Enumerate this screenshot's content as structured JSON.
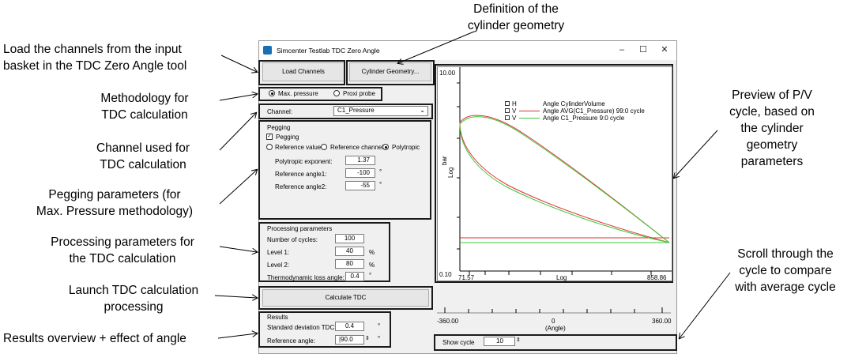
{
  "window": {
    "title": "Simcenter Testlab TDC Zero Angle",
    "minimize": "–",
    "maximize": "☐",
    "close": "✕"
  },
  "buttons": {
    "load_channels": "Load Channels",
    "cylinder_geometry": "Cylinder Geometry...",
    "calculate_tdc": "Calculate TDC"
  },
  "method": {
    "max_pressure": "Max. pressure",
    "proxi_probe": "Proxi probe",
    "selected": "max_pressure"
  },
  "channel": {
    "label": "Channel:",
    "value": "C1_Pressure"
  },
  "pegging": {
    "group": "Pegging",
    "checkbox_label": "Pegging",
    "checked": true,
    "options": [
      "Reference value",
      "Reference channel",
      "Polytropic"
    ],
    "selected": "Polytropic",
    "polytropic_exponent_label": "Polytropic exponent:",
    "polytropic_exponent": "1.37",
    "ref_angle1_label": "Reference angle1:",
    "ref_angle1": "-100",
    "ref_angle2_label": "Reference angle2:",
    "ref_angle2": "-55",
    "unit_deg": "°"
  },
  "processing": {
    "group": "Processing parameters",
    "cycles_label": "Number of cycles:",
    "cycles": "100",
    "level1_label": "Level 1:",
    "level1": "40",
    "level2_label": "Level 2:",
    "level2": "80",
    "pct": "%",
    "thermo_label": "Thermodynamic loss angle:",
    "thermo": "0.4",
    "unit_deg": "°"
  },
  "results": {
    "group": "Results",
    "std_label": "Standard deviation TDC:",
    "std": "0.4",
    "ref_label": "Reference angle:",
    "ref": "|90.0",
    "unit_deg": "°"
  },
  "plot": {
    "y_top": "10.00",
    "y_bottom": "0.10",
    "y_label": "bar",
    "y_scale": "Log",
    "x_left": "71.57",
    "x_right": "858.86",
    "x_scale": "Log",
    "legend": [
      {
        "type": "H",
        "text": "Angle CylinderVolume",
        "color": "#ffffff"
      },
      {
        "type": "V",
        "text": "Angle AVG(C1_Pressure) 99:0 cycle",
        "color": "#e03030"
      },
      {
        "type": "V",
        "text": "Angle C1_Pressure 9:0 cycle",
        "color": "#3cc83c"
      }
    ]
  },
  "angle_axis": {
    "left": "-360.00",
    "right": "360.00",
    "mid": "0",
    "label": "(Angle)"
  },
  "show_cycle": {
    "label": "Show cycle",
    "value": "10"
  },
  "callouts": {
    "load_channels": [
      "Load the channels from the input",
      "basket in the TDC Zero Angle tool"
    ],
    "geometry": [
      "Definition of the",
      "cylinder geometry"
    ],
    "methodology": [
      "Methodology for",
      "TDC calculation"
    ],
    "channel": [
      "Channel used for",
      "TDC calculation"
    ],
    "pegging": [
      "Pegging parameters (for",
      "Max. Pressure methodology)"
    ],
    "processing": [
      "Processing parameters for",
      "the TDC calculation"
    ],
    "launch": [
      "Launch TDC calculation",
      "processing"
    ],
    "results": [
      "Results overview + effect of angle"
    ],
    "preview": [
      "Preview of P/V",
      "cycle, based on",
      "the cylinder",
      "geometry",
      "parameters"
    ],
    "scroll": [
      "Scroll through the",
      "cycle to compare",
      "with average cycle"
    ]
  }
}
